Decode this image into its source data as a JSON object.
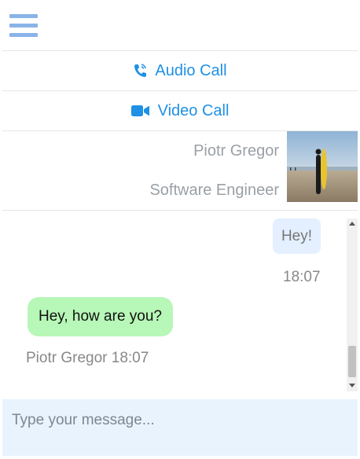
{
  "header": {
    "menu_icon": "hamburger-icon"
  },
  "actions": {
    "audio_call": {
      "label": "Audio Call",
      "icon": "phone-icon"
    },
    "video_call": {
      "label": "Video Call",
      "icon": "video-camera-icon"
    }
  },
  "contact": {
    "name": "Piotr Gregor",
    "title": "Software Engineer",
    "avatar": "profile-photo"
  },
  "messages": [
    {
      "direction": "outgoing",
      "text": "Hey!",
      "time": "18:07"
    },
    {
      "direction": "incoming",
      "text": "Hey, how are you?",
      "meta": "Piotr Gregor 18:07"
    }
  ],
  "composer": {
    "placeholder": "Type your message..."
  },
  "colors": {
    "accent": "#1e90e6",
    "menu_icon": "#8ab4e8",
    "outgoing_bubble": "#e4efff",
    "incoming_bubble": "#b7f7b7",
    "composer_bg": "#e8f3fd"
  }
}
